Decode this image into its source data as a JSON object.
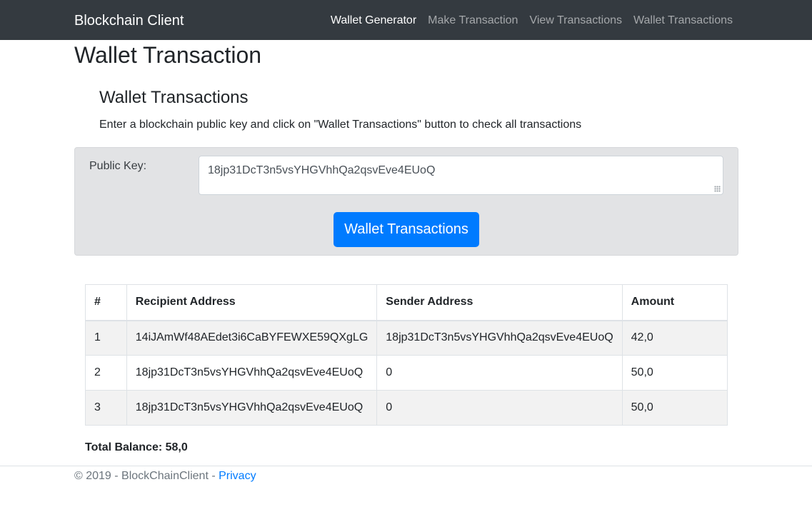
{
  "navbar": {
    "brand": "Blockchain Client",
    "links": [
      {
        "label": "Wallet Generator",
        "active": true
      },
      {
        "label": "Make Transaction",
        "active": false
      },
      {
        "label": "View Transactions",
        "active": false
      },
      {
        "label": "Wallet Transactions",
        "active": false
      }
    ]
  },
  "page": {
    "title": "Wallet Transaction",
    "section_title": "Wallet Transactions",
    "instructions": "Enter a blockchain public key and click on \"Wallet Transactions\" button to check all transactions"
  },
  "form": {
    "public_key_label": "Public Key:",
    "public_key_value": "18jp31DcT3n5vsYHGVhhQa2qsvEve4EUoQ",
    "submit_label": "Wallet Transactions"
  },
  "table": {
    "headers": [
      "#",
      "Recipient Address",
      "Sender Address",
      "Amount"
    ],
    "rows": [
      [
        "1",
        "14iJAmWf48AEdet3i6CaBYFEWXE59QXgLG",
        "18jp31DcT3n5vsYHGVhhQa2qsvEve4EUoQ",
        "42,0"
      ],
      [
        "2",
        "18jp31DcT3n5vsYHGVhhQa2qsvEve4EUoQ",
        "0",
        "50,0"
      ],
      [
        "3",
        "18jp31DcT3n5vsYHGVhhQa2qsvEve4EUoQ",
        "0",
        "50,0"
      ]
    ]
  },
  "balance": {
    "label": "Total Balance:",
    "value": "58,0"
  },
  "footer": {
    "text": "© 2019 - BlockChainClient - ",
    "privacy_link": "Privacy"
  },
  "colors": {
    "navbar_bg": "#343a40",
    "primary": "#007bff",
    "panel_bg": "#e2e3e5"
  }
}
